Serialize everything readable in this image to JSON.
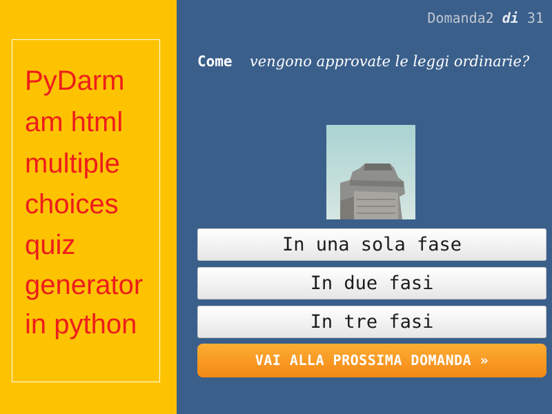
{
  "sidebar": {
    "title_lines": [
      "PyDarm",
      "am html",
      "multiple",
      "choices",
      "quiz",
      "generator",
      "in python"
    ]
  },
  "counter": {
    "label": "Domanda",
    "current": "2",
    "of": "di",
    "total": "31"
  },
  "question": {
    "lead": "Come",
    "rest": "vengono approvate le leggi ordinarie?"
  },
  "image": {
    "icon": "fortress-tower-photo"
  },
  "answers": [
    {
      "label": "In una sola fase"
    },
    {
      "label": "In due fasi"
    },
    {
      "label": "In tre fasi"
    }
  ],
  "next_button": {
    "label": "VAI ALLA PROSSIMA DOMANDA »"
  },
  "colors": {
    "left_panel": "#fdc300",
    "title_text": "#ee1c1c",
    "main_background": "#3a5f8b",
    "next_button": "#f7941d"
  }
}
